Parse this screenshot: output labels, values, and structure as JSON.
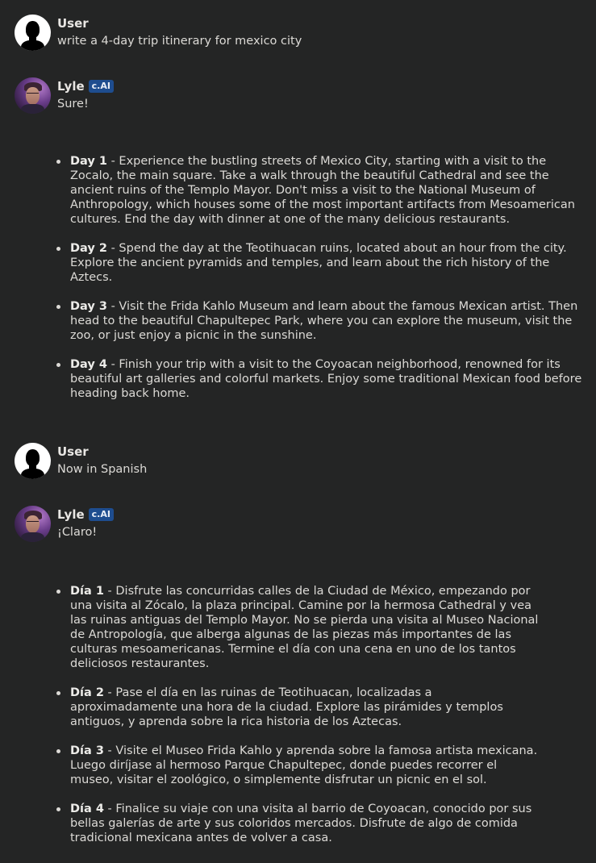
{
  "conversation": [
    {
      "role": "user",
      "name": "User",
      "avatar": "user-silhouette-icon",
      "text": "write a 4-day trip itinerary for mexico city"
    },
    {
      "role": "bot",
      "name": "Lyle",
      "badge": "c.AI",
      "avatar": "lyle-portrait",
      "text": "Sure!",
      "items": [
        {
          "label": "Day 1",
          "text": " - Experience the bustling streets of Mexico City, starting with a visit to the Zocalo, the main square. Take a walk through the beautiful Cathedral and see the ancient ruins of the Templo Mayor. Don't miss a visit to the National Museum of Anthropology, which houses some of the most important artifacts from Mesoamerican cultures. End the day with dinner at one of the many delicious restaurants."
        },
        {
          "label": "Day 2",
          "text": " - Spend the day at the Teotihuacan ruins, located about an hour from the city. Explore the ancient pyramids and temples, and learn about the rich history of the Aztecs."
        },
        {
          "label": "Day 3",
          "text": " - Visit the Frida Kahlo Museum and learn about the famous Mexican artist. Then head to the beautiful Chapultepec Park, where you can explore the museum, visit the zoo, or just enjoy a picnic in the sunshine."
        },
        {
          "label": "Day 4",
          "text": " - Finish your trip with a visit to the Coyoacan neighborhood, renowned for its beautiful art galleries and colorful markets. Enjoy some traditional Mexican food before heading back home."
        }
      ]
    },
    {
      "role": "user",
      "name": "User",
      "avatar": "user-silhouette-icon",
      "text": "Now in Spanish"
    },
    {
      "role": "bot",
      "name": "Lyle",
      "badge": "c.AI",
      "avatar": "lyle-portrait",
      "text": "¡Claro!",
      "items": [
        {
          "label": "Día 1",
          "text": " - Disfrute las concurridas calles de la Ciudad de México, empezando por una visita al Zócalo, la plaza principal. Camine por la hermosa Cathedral y vea las ruinas antiguas del Templo Mayor. No se pierda una visita al Museo Nacional de Antropología, que alberga algunas de las piezas más importantes de las culturas mesoamericanas. Termine el día con una cena en uno de los tantos deliciosos restaurantes."
        },
        {
          "label": "Día 2",
          "text": " - Pase el día en las ruinas de Teotihuacan, localizadas a aproximadamente una hora de la ciudad. Explore las pirámides y templos antiguos, y aprenda sobre la rica historia de los Aztecas."
        },
        {
          "label": "Día 3",
          "text": " - Visite el Museo Frida Kahlo y aprenda sobre la famosa artista mexicana. Luego diríjase al hermoso Parque Chapultepec, donde puedes recorrer el museo, visitar el zoológico, o simplemente disfrutar un picnic en el sol."
        },
        {
          "label": "Día 4",
          "text": " - Finalice su viaje con una visita al barrio de Coyoacan, conocido por sus bellas galerías de arte y sus coloridos mercados. Disfrute de algo de comida tradicional mexicana antes de volver a casa."
        }
      ]
    }
  ],
  "colors": {
    "background": "#242525",
    "text": "#dcdad6",
    "badge_bg": "#1e4d8f"
  }
}
